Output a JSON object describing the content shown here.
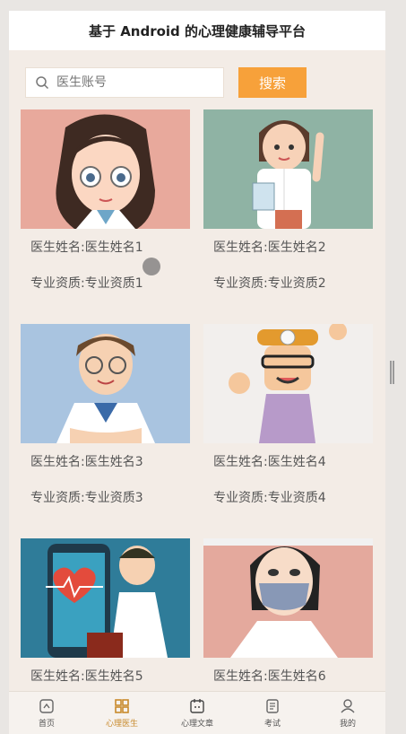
{
  "app": {
    "title": "基于 Android 的心理健康辅导平台"
  },
  "search": {
    "placeholder": "医生账号",
    "button_label": "搜索"
  },
  "doctors": [
    {
      "name": "医生姓名:医生姓名1",
      "qualification": "专业资质:专业资质1"
    },
    {
      "name": "医生姓名:医生姓名2",
      "qualification": "专业资质:专业资质2"
    },
    {
      "name": "医生姓名:医生姓名3",
      "qualification": "专业资质:专业资质3"
    },
    {
      "name": "医生姓名:医生姓名4",
      "qualification": "专业资质:专业资质4"
    },
    {
      "name": "医生姓名:医生姓名5"
    },
    {
      "name": "医生姓名:医生姓名6"
    }
  ],
  "tabbar": [
    {
      "label": "首页",
      "icon": "home-icon"
    },
    {
      "label": "心理医生",
      "icon": "grid-icon",
      "active": true
    },
    {
      "label": "心理文章",
      "icon": "calendar-icon"
    },
    {
      "label": "考试",
      "icon": "exam-icon"
    },
    {
      "label": "我的",
      "icon": "user-icon"
    }
  ],
  "colors": {
    "accent": "#f7a13a",
    "background": "#f3ece6",
    "active_tab": "#c88a2c"
  }
}
